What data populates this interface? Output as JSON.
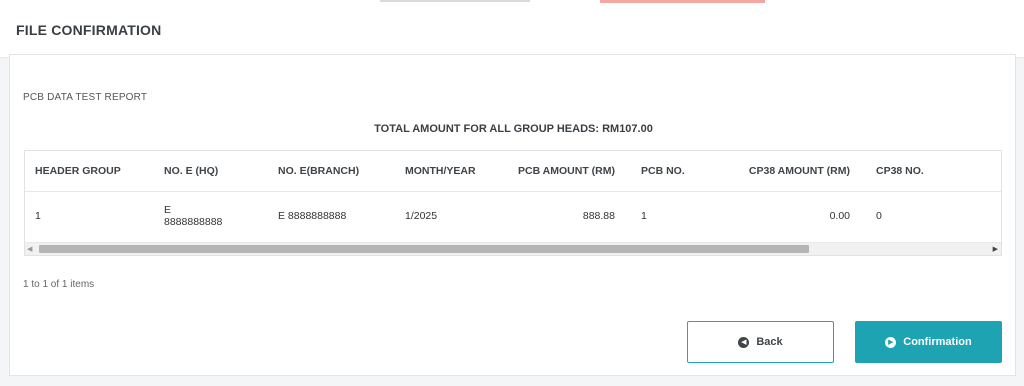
{
  "page": {
    "title": "FILE CONFIRMATION"
  },
  "report": {
    "name": "PCB DATA TEST REPORT",
    "total_label": "TOTAL AMOUNT FOR ALL GROUP HEADS: RM107.00"
  },
  "table": {
    "columns": [
      "HEADER GROUP",
      "NO. E (HQ)",
      "NO. E(BRANCH)",
      "MONTH/YEAR",
      "PCB AMOUNT (RM)",
      "PCB NO.",
      "CP38 AMOUNT (RM)",
      "CP38 NO."
    ],
    "rows": [
      {
        "header_group": "1",
        "no_e_hq_prefix": "E",
        "no_e_hq_number": "8888888888",
        "no_e_branch": "E 8888888888",
        "month_year": "1/2025",
        "pcb_amount": "888.88",
        "pcb_no": "1",
        "cp38_amount": "0.00",
        "cp38_no": "0"
      }
    ]
  },
  "pager": {
    "info": "1 to 1 of 1 items"
  },
  "actions": {
    "back_label": "Back",
    "confirm_label": "Confirmation",
    "back_icon": "arrow-left-circle-icon",
    "confirm_icon": "arrow-right-circle-icon"
  },
  "colors": {
    "accent": "#1ea3b2"
  }
}
